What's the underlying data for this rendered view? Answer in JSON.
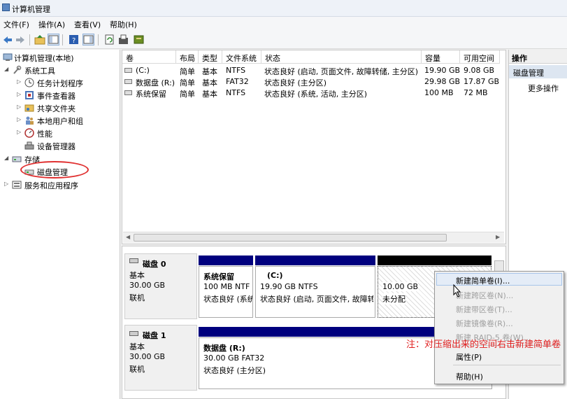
{
  "window": {
    "title": "计算机管理"
  },
  "menu": [
    {
      "label": "文件(F)"
    },
    {
      "label": "操作(A)"
    },
    {
      "label": "查看(V)"
    },
    {
      "label": "帮助(H)"
    }
  ],
  "tree": {
    "root": "计算机管理(本地)",
    "system_tools": "系统工具",
    "task_scheduler": "任务计划程序",
    "event_viewer": "事件查看器",
    "shared_folders": "共享文件夹",
    "local_users": "本地用户和组",
    "performance": "性能",
    "device_manager": "设备管理器",
    "storage": "存储",
    "disk_management": "磁盘管理",
    "services_apps": "服务和应用程序"
  },
  "volumes": {
    "headers": [
      "卷",
      "布局",
      "类型",
      "文件系统",
      "状态",
      "容量",
      "可用空间"
    ],
    "rows": [
      [
        "(C:)",
        "简单",
        "基本",
        "NTFS",
        "状态良好 (启动, 页面文件, 故障转储, 主分区)",
        "19.90 GB",
        "9.08 GB"
      ],
      [
        "数据盘 (R:)",
        "简单",
        "基本",
        "FAT32",
        "状态良好 (主分区)",
        "29.98 GB",
        "17.87 GB"
      ],
      [
        "系统保留",
        "简单",
        "基本",
        "NTFS",
        "状态良好 (系统, 活动, 主分区)",
        "100 MB",
        "72 MB"
      ]
    ]
  },
  "disks": [
    {
      "name": "磁盘 0",
      "type": "基本",
      "size": "30.00 GB",
      "status": "联机",
      "partitions": [
        {
          "name": "系统保留",
          "size": "100 MB NTF",
          "status": "状态良好 (系统"
        },
        {
          "name": "(C:)",
          "size": "19.90 GB NTFS",
          "status": "状态良好 (启动, 页面文件, 故障转"
        },
        {
          "size": "10.00 GB",
          "status": "未分配"
        }
      ]
    },
    {
      "name": "磁盘 1",
      "type": "基本",
      "size": "30.00 GB",
      "status": "联机",
      "partitions": [
        {
          "name": "数据盘  (R:)",
          "size": "30.00 GB FAT32",
          "status": "状态良好 (主分区)"
        }
      ]
    }
  ],
  "actions": {
    "header": "操作",
    "section": "磁盘管理",
    "more": "更多操作"
  },
  "context_menu": {
    "new_simple": "新建简单卷(I)...",
    "new_spanned": "新建跨区卷(N)...",
    "new_striped": "新建带区卷(T)...",
    "new_mirrored": "新建镜像卷(R)...",
    "new_raid5": "新建 RAID-5 卷(W)...",
    "properties": "属性(P)",
    "help": "帮助(H)"
  },
  "annotation": "注：对压缩出来的空间右击新建简单卷",
  "colors": {
    "primary_partition_bar": "#00007e",
    "unallocated_bar": "#000000",
    "annotation": "#e02020",
    "selection": "#dfe8f4"
  }
}
